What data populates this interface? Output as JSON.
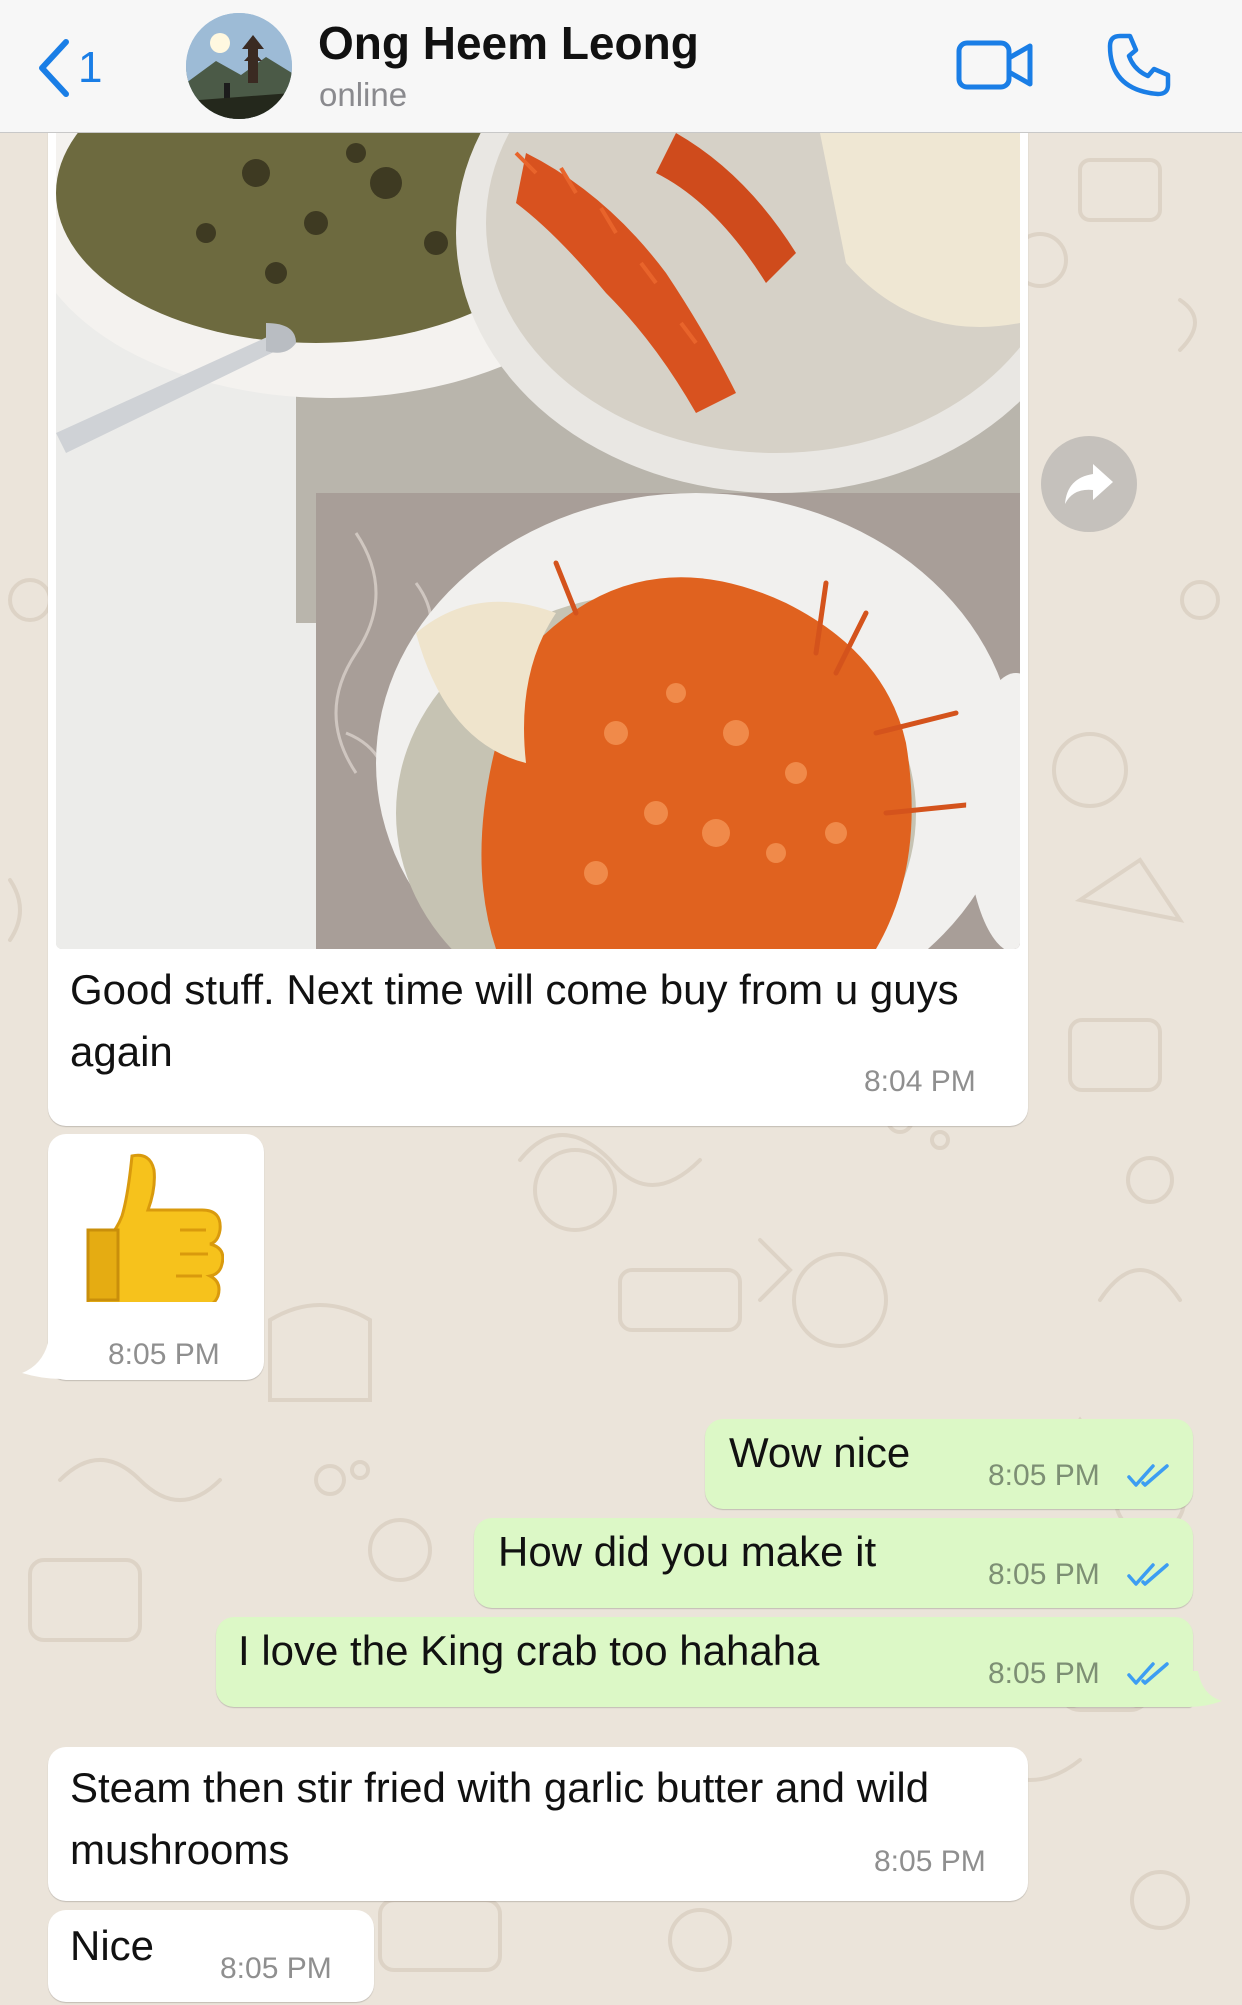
{
  "header": {
    "back_count": "1",
    "contact_name": "Ong Heem Leong",
    "status": "online",
    "icons": {
      "back": "chevron-left-icon",
      "video": "video-camera-icon",
      "call": "phone-icon"
    },
    "accent_color": "#1a7ee6"
  },
  "messages": [
    {
      "direction": "incoming",
      "type": "image",
      "caption": "Good stuff. Next time will come buy from u guys again",
      "time": "8:04 PM"
    },
    {
      "direction": "incoming",
      "type": "emoji",
      "emoji": "👍",
      "time": "8:05 PM"
    },
    {
      "direction": "outgoing",
      "text": "Wow nice",
      "time": "8:05 PM",
      "status": "read"
    },
    {
      "direction": "outgoing",
      "text": "How did you make it",
      "time": "8:05 PM",
      "status": "read"
    },
    {
      "direction": "outgoing",
      "text": "I love the King crab too hahaha",
      "time": "8:05 PM",
      "status": "read"
    },
    {
      "direction": "incoming",
      "text": "Steam then stir fried with garlic butter and wild mushrooms",
      "time": "8:05 PM"
    },
    {
      "direction": "incoming",
      "text": "Nice",
      "time": "8:05 PM"
    }
  ],
  "colors": {
    "incoming_bubble": "#ffffff",
    "outgoing_bubble": "#dcf8c6",
    "read_ticks": "#3d9df2",
    "wallpaper": "#ebe4da"
  }
}
